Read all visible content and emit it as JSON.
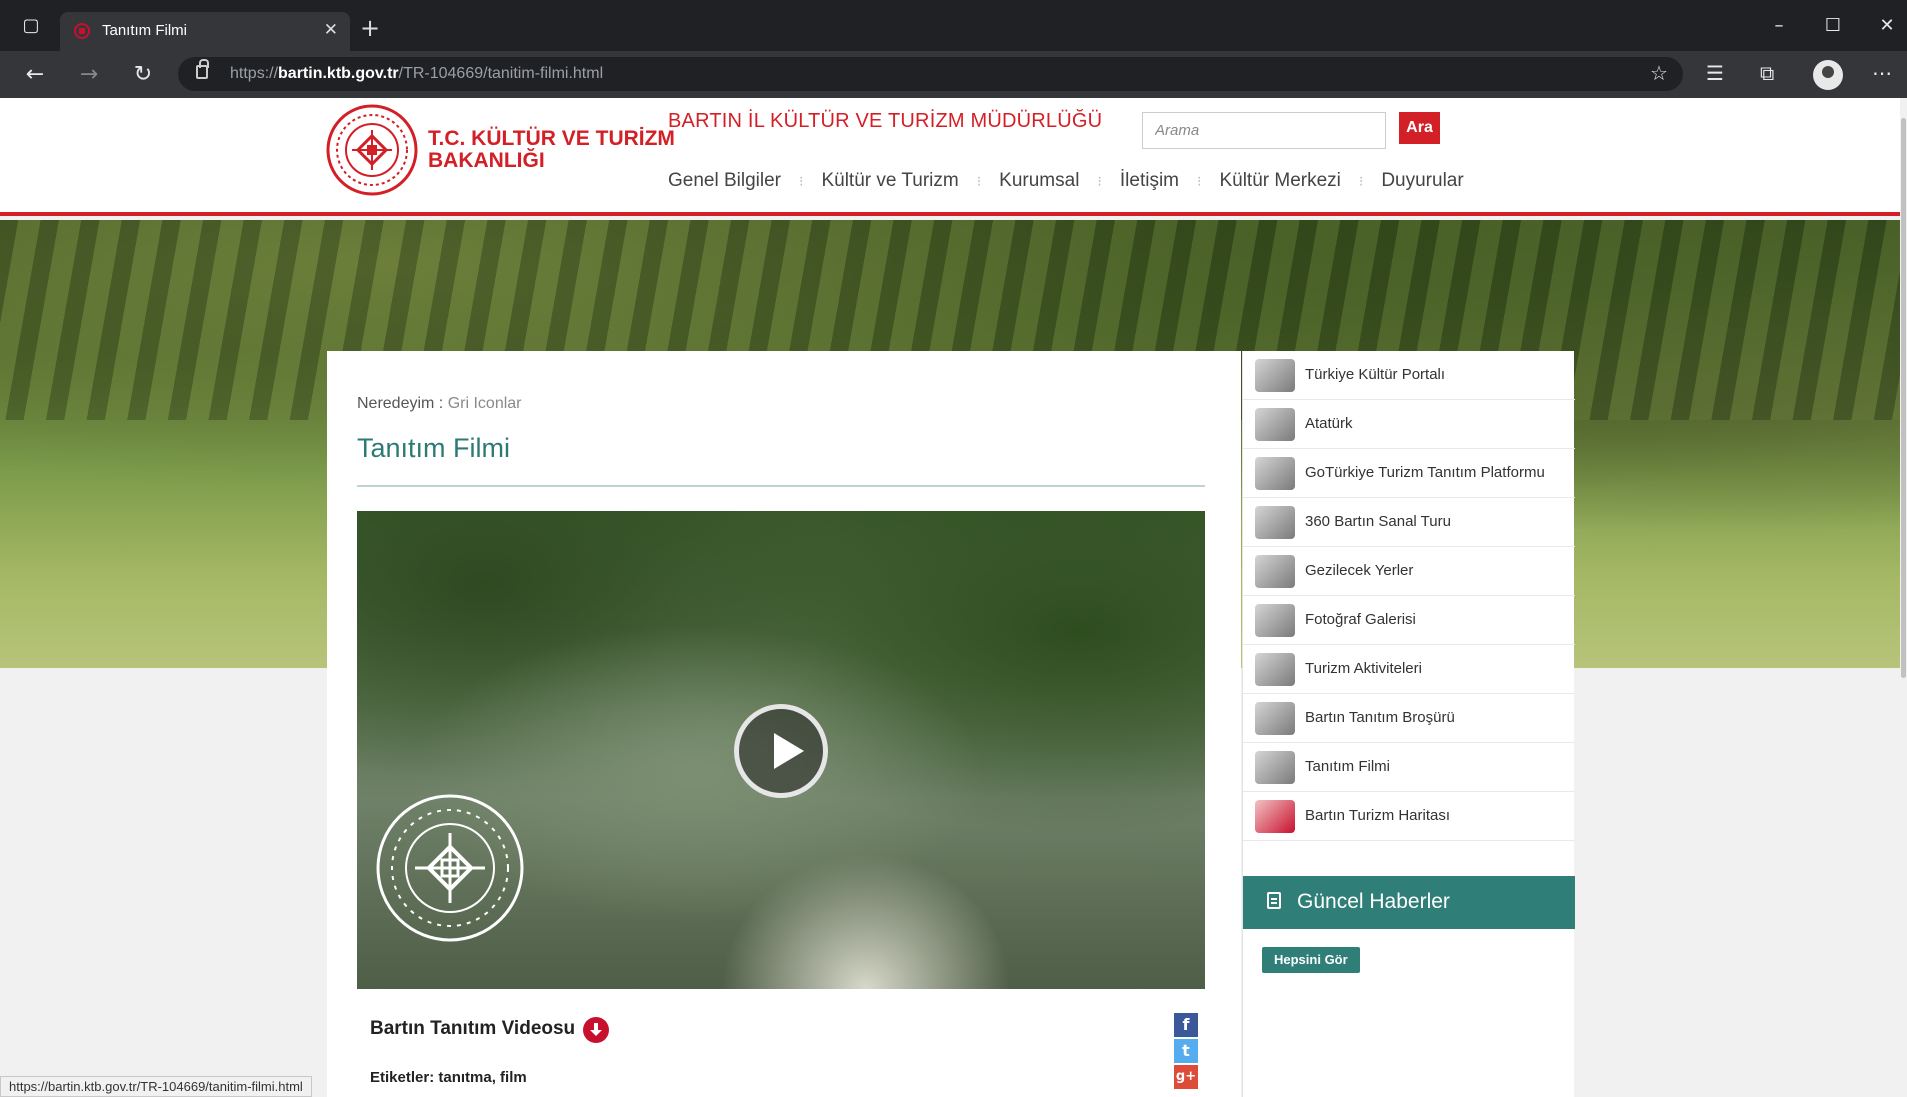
{
  "browser": {
    "tab_title": "Tanıtım Filmi",
    "url_prefix": "https://",
    "url_host": "bartin.ktb.gov.tr",
    "url_path": "/TR-104669/tanitim-filmi.html"
  },
  "header": {
    "logo_line1": "T.C. KÜLTÜR VE TURİZM",
    "logo_line2": "BAKANLIĞI",
    "dept_title": "BARTIN İL KÜLTÜR VE TURİZM MÜDÜRLÜĞÜ",
    "search_placeholder": "Arama",
    "search_button": "Ara",
    "nav": [
      "Genel Bilgiler",
      "Kültür ve Turizm",
      "Kurumsal",
      "İletişim",
      "Kültür Merkezi",
      "Duyurular"
    ]
  },
  "content": {
    "breadcrumb_label": "Neredeyim :",
    "breadcrumb_current": "Gri Iconlar",
    "title": "Tanıtım Filmi",
    "video_caption": "Bartın Tanıtım Videosu",
    "tags": "Etiketler: tanıtma, film"
  },
  "sidebar": {
    "items": [
      {
        "label": "Türkiye Kültür Portalı"
      },
      {
        "label": "Atatürk"
      },
      {
        "label": "GoTürkiye Turizm Tanıtım Platformu"
      },
      {
        "label": "360 Bartın Sanal Turu"
      },
      {
        "label": "Gezilecek Yerler"
      },
      {
        "label": "Fotoğraf Galerisi"
      },
      {
        "label": "Turizm Aktiviteleri"
      },
      {
        "label": "Bartın Tanıtım Broşürü"
      },
      {
        "label": "Tanıtım Filmi"
      },
      {
        "label": "Bartın Turizm Haritası"
      }
    ],
    "news_title": "Güncel Haberler",
    "see_all": "Hepsini Gör"
  },
  "status_bar": "https://bartin.ktb.gov.tr/TR-104669/tanitim-filmi.html",
  "colors": {
    "brand_red": "#d31f26",
    "teal": "#2f7f78"
  }
}
